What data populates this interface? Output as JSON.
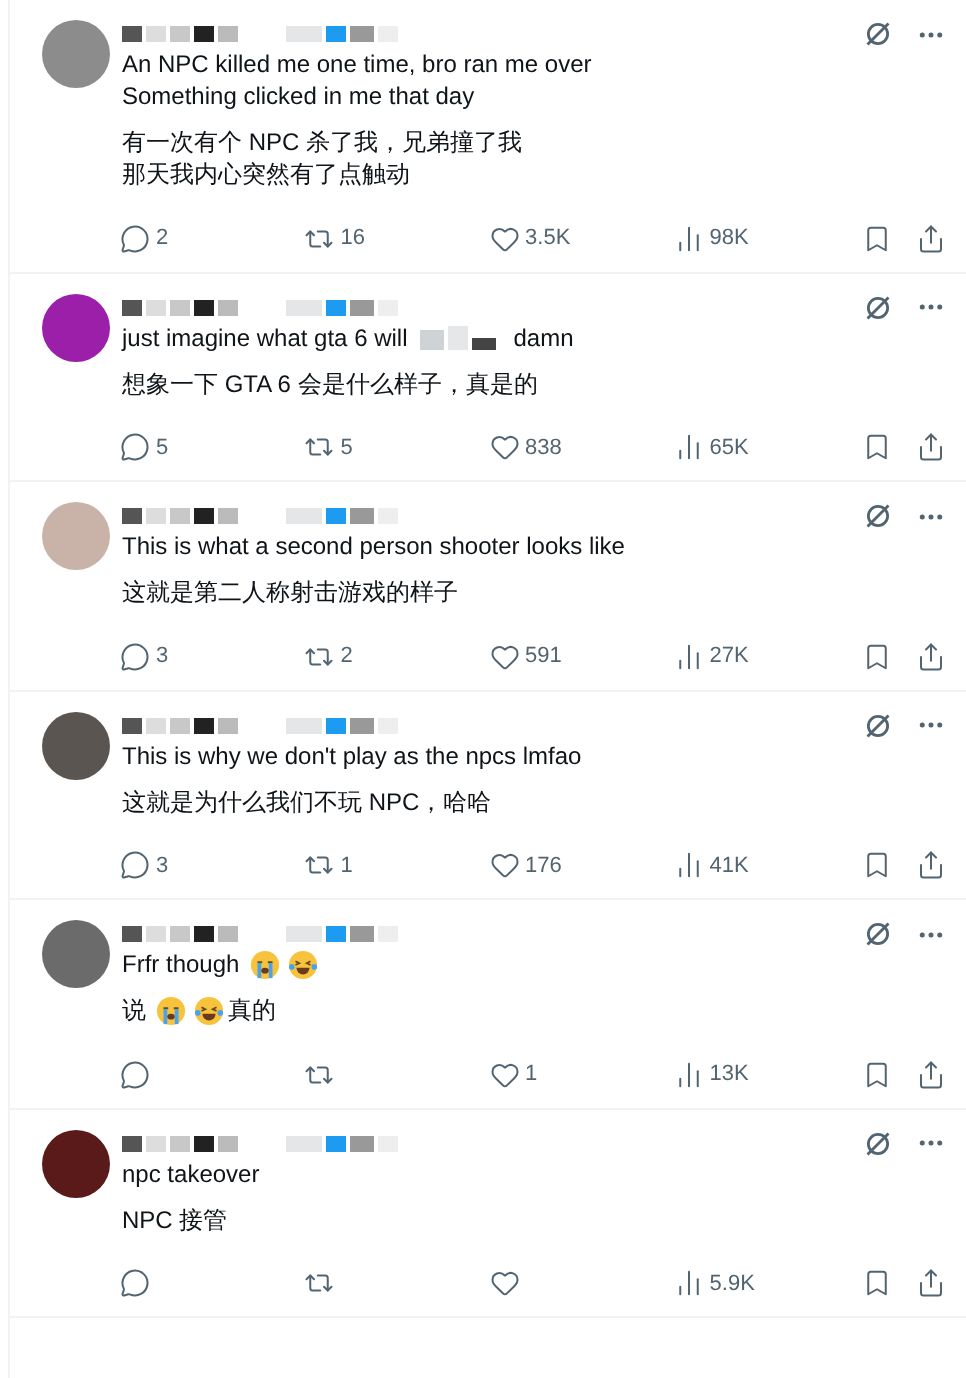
{
  "posts": [
    {
      "color": "#8c8c8c",
      "original": [
        [
          {
            "kind": "text",
            "text": "An NPC killed me one time, bro ran me over"
          }
        ],
        [
          {
            "kind": "text",
            "text": "Something clicked in me that day"
          }
        ]
      ],
      "translation": [
        [
          {
            "kind": "text",
            "text": "有一次有个 NPC 杀了我，兄弟撞了我"
          }
        ],
        [
          {
            "kind": "text",
            "text": "那天我内心突然有了点触动"
          }
        ]
      ],
      "replies": "2",
      "reposts": "16",
      "likes": "3.5K",
      "views": "98K"
    },
    {
      "color": "#9b1fa8",
      "original": [
        [
          {
            "kind": "text",
            "text": "just imagine what gta 6 will"
          },
          {
            "kind": "redacted"
          },
          {
            "kind": "text",
            "text": "damn"
          }
        ]
      ],
      "translation": [
        [
          {
            "kind": "text",
            "text": "想象一下 GTA 6 会是什么样子，真是的"
          }
        ]
      ],
      "replies": "5",
      "reposts": "5",
      "likes": "838",
      "views": "65K"
    },
    {
      "color": "#c9b3a8",
      "original": [
        [
          {
            "kind": "text",
            "text": "This is what a second person shooter looks like"
          }
        ]
      ],
      "translation": [
        [
          {
            "kind": "text",
            "text": "这就是第二人称射击游戏的样子"
          }
        ]
      ],
      "replies": "3",
      "reposts": "2",
      "likes": "591",
      "views": "27K"
    },
    {
      "color": "#5a5550",
      "original": [
        [
          {
            "kind": "text",
            "text": "This is why we don't play as the npcs lmfao"
          }
        ]
      ],
      "translation": [
        [
          {
            "kind": "text",
            "text": "这就是为什么我们不玩 NPC，哈哈"
          }
        ]
      ],
      "replies": "3",
      "reposts": "1",
      "likes": "176",
      "views": "41K"
    },
    {
      "color": "#6b6b6b",
      "original": [
        [
          {
            "kind": "text",
            "text": "Frfr though"
          },
          {
            "kind": "sob"
          },
          {
            "kind": "joy"
          }
        ]
      ],
      "translation": [
        [
          {
            "kind": "text",
            "text": "说"
          },
          {
            "kind": "sob"
          },
          {
            "kind": "joy"
          },
          {
            "kind": "text",
            "text": "真的"
          }
        ]
      ],
      "likes": "1",
      "views": "13K"
    },
    {
      "color": "#5a1a1a",
      "original": [
        [
          {
            "kind": "text",
            "text": "npc takeover"
          }
        ]
      ],
      "translation": [
        [
          {
            "kind": "text",
            "text": "NPC 接管"
          }
        ]
      ],
      "views": "5.9K"
    }
  ]
}
